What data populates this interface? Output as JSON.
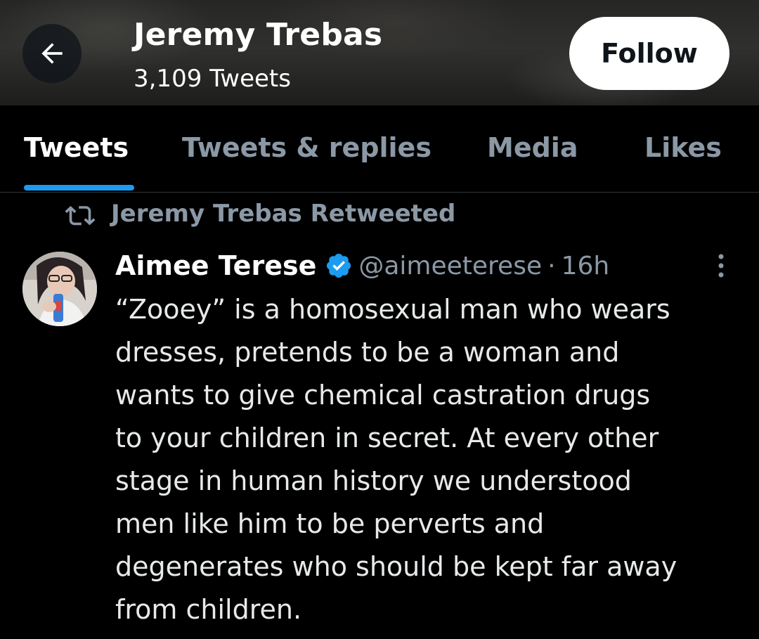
{
  "header": {
    "back_icon": "arrow-left-icon",
    "title": "Jeremy Trebas",
    "tweet_count": "3,109 Tweets",
    "follow_label": "Follow"
  },
  "tabs": [
    {
      "label": "Tweets",
      "active": true
    },
    {
      "label": "Tweets & replies",
      "active": false
    },
    {
      "label": "Media",
      "active": false
    },
    {
      "label": "Likes",
      "active": false
    }
  ],
  "retweet_context": {
    "icon": "retweet-icon",
    "text": "Jeremy Trebas Retweeted"
  },
  "tweet": {
    "author_name": "Aimee Terese",
    "verified_icon": "verified-badge-icon",
    "handle": "@aimeeterese",
    "separator": "·",
    "time": "16h",
    "more_icon": "more-vertical-icon",
    "lines": [
      "“Zooey” is a homosexual man who wears",
      "dresses, pretends to be a woman and",
      "wants to give chemical castration drugs",
      "to your children in secret. At every other",
      "stage in human history we understood",
      "men like him to be perverts and",
      "degenerates who should be kept far away",
      "from children."
    ]
  },
  "colors": {
    "background": "#000000",
    "accent": "#1d9bf0",
    "secondary_text": "#8b98a5",
    "primary_text": "#e7e9ea"
  }
}
